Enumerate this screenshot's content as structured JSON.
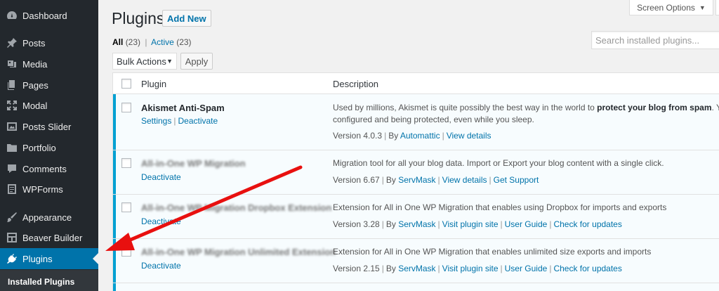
{
  "sidebar": {
    "items": [
      {
        "label": "Dashboard",
        "icon": "dashboard-icon"
      },
      {
        "label": "Posts",
        "icon": "pin-icon"
      },
      {
        "label": "Media",
        "icon": "media-icon"
      },
      {
        "label": "Pages",
        "icon": "pages-icon"
      },
      {
        "label": "Modal",
        "icon": "expand-icon"
      },
      {
        "label": "Posts Slider",
        "icon": "slider-icon"
      },
      {
        "label": "Portfolio",
        "icon": "folder-icon"
      },
      {
        "label": "Comments",
        "icon": "comment-icon"
      },
      {
        "label": "WPForms",
        "icon": "form-icon"
      },
      {
        "label": "Appearance",
        "icon": "brush-icon"
      },
      {
        "label": "Beaver Builder",
        "icon": "layout-icon"
      },
      {
        "label": "Plugins",
        "icon": "plugin-icon"
      }
    ],
    "submenu": {
      "label": "Installed Plugins"
    }
  },
  "header": {
    "title": "Plugins",
    "add_new": "Add New",
    "screen_options": "Screen Options"
  },
  "filters": {
    "all_label": "All",
    "all_count": "(23)",
    "separator": "|",
    "active_label": "Active",
    "active_count": "(23)"
  },
  "search": {
    "placeholder": "Search installed plugins..."
  },
  "bulk": {
    "label": "Bulk Actions",
    "apply": "Apply"
  },
  "table": {
    "col_plugin": "Plugin",
    "col_description": "Description",
    "rows": [
      {
        "name": "Akismet Anti-Spam",
        "action1": "Settings",
        "action2": "Deactivate",
        "desc_pre": "Used by millions, Akismet is quite possibly the best way in the world to ",
        "desc_bold": "protect your blog from spam",
        "desc_post": ". Your site",
        "desc_line2": "configured and being protected, even while you sleep.",
        "version": "Version 4.0.3",
        "by": "By",
        "author": "Automattic",
        "link1": "View details"
      },
      {
        "name": "All-in-One WP Migration",
        "action1": "Deactivate",
        "desc": "Migration tool for all your blog data. Import or Export your blog content with a single click.",
        "version": "Version 6.67",
        "by": "By",
        "author": "ServMask",
        "link1": "View details",
        "link2": "Get Support"
      },
      {
        "name": "All-in-One WP Migration Dropbox Extension",
        "action1": "Deactivate",
        "desc": "Extension for All in One WP Migration that enables using Dropbox for imports and exports",
        "version": "Version 3.28",
        "by": "By",
        "author": "ServMask",
        "link1": "Visit plugin site",
        "link2": "User Guide",
        "link3": "Check for updates"
      },
      {
        "name": "All-in-One WP Migration Unlimited Extension",
        "action1": "Deactivate",
        "desc": "Extension for All in One WP Migration that enables unlimited size exports and imports",
        "version": "Version 2.15",
        "by": "By",
        "author": "ServMask",
        "link1": "Visit plugin site",
        "link2": "User Guide",
        "link3": "Check for updates"
      }
    ]
  },
  "colors": {
    "accent": "#0073aa",
    "active_border": "#00a0d2",
    "sidebar_bg": "#23282d",
    "arrow": "#e8100f"
  }
}
